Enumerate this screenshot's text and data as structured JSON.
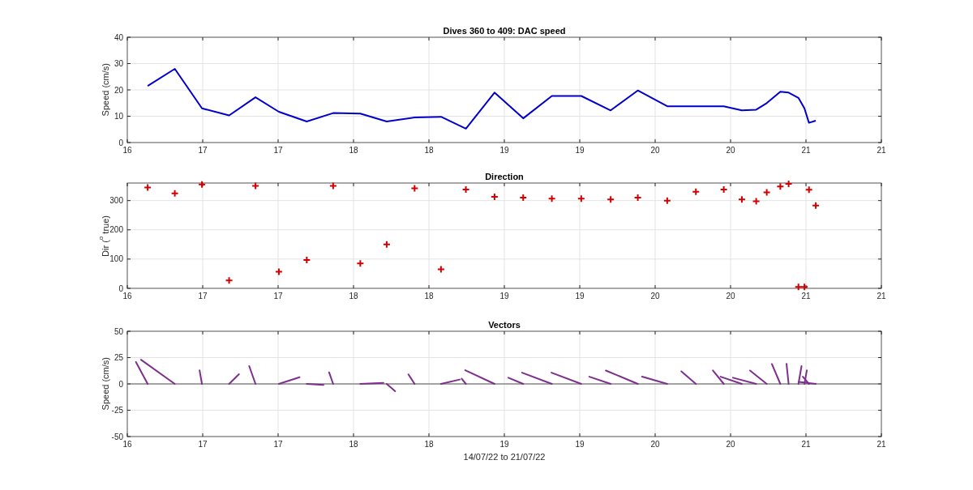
{
  "figure": {
    "panels": [
      {
        "kind": "chart",
        "chart_data": {
          "type": "line",
          "title": "Dives 360 to 409: DAC speed",
          "ylabel": "Speed (cm/s)",
          "x": [
            16.135,
            16.315,
            16.495,
            16.675,
            16.85,
            17.005,
            17.19,
            17.365,
            17.545,
            17.72,
            17.905,
            18.08,
            18.245,
            18.435,
            18.625,
            18.815,
            19.01,
            19.205,
            19.385,
            19.58,
            19.77,
            19.955,
            20.075,
            20.17,
            20.24,
            20.33,
            20.385,
            20.45,
            20.49,
            20.52,
            20.565
          ],
          "series": [
            {
              "color": "#0000cd",
              "values": [
                21.5,
                28,
                13,
                10.3,
                17.2,
                11.7,
                8,
                11.2,
                11,
                8,
                9.5,
                9.8,
                5.3,
                19,
                9.2,
                17.7,
                17.7,
                12.2,
                19.8,
                13.8,
                13.8,
                13.8,
                12.2,
                12.5,
                15,
                19.3,
                19,
                17,
                13,
                7.5,
                8.3
              ]
            }
          ],
          "xlim": [
            16,
            21
          ],
          "ylim": [
            0,
            40
          ],
          "xticks": [
            {
              "value": 16,
              "label": "16"
            },
            {
              "value": 16.5,
              "label": "17"
            },
            {
              "value": 17,
              "label": "17"
            },
            {
              "value": 17.5,
              "label": "18"
            },
            {
              "value": 18,
              "label": "18"
            },
            {
              "value": 18.5,
              "label": "19"
            },
            {
              "value": 19,
              "label": "19"
            },
            {
              "value": 19.5,
              "label": "20"
            },
            {
              "value": 20,
              "label": "20"
            },
            {
              "value": 20.5,
              "label": "21"
            },
            {
              "value": 21,
              "label": "21"
            }
          ],
          "yticks": [
            0,
            10,
            20,
            30,
            40
          ],
          "grid": true
        }
      },
      {
        "kind": "chart",
        "chart_data": {
          "type": "scatter",
          "title": "Direction",
          "ylabel": "Dir ($^{o}$ true)",
          "x": [
            16.135,
            16.315,
            16.495,
            16.675,
            16.85,
            17.005,
            17.19,
            17.365,
            17.545,
            17.72,
            17.905,
            18.08,
            18.245,
            18.435,
            18.625,
            18.815,
            19.01,
            19.205,
            19.385,
            19.58,
            19.77,
            19.955,
            20.075,
            20.17,
            20.24,
            20.33,
            20.385,
            20.45,
            20.49,
            20.52,
            20.565
          ],
          "series": [
            {
              "color": "#d40000",
              "values": [
                345,
                325,
                355,
                27,
                350,
                57,
                97,
                350,
                85,
                150,
                342,
                65,
                338,
                313,
                310,
                307,
                307,
                304,
                310,
                300,
                330,
                338,
                304,
                298,
                328,
                348,
                357,
                5,
                5,
                337,
                283
              ]
            }
          ],
          "xlim": [
            16,
            21
          ],
          "ylim": [
            0,
            360
          ],
          "xticks": [
            {
              "value": 16,
              "label": "16"
            },
            {
              "value": 16.5,
              "label": "17"
            },
            {
              "value": 17,
              "label": "17"
            },
            {
              "value": 17.5,
              "label": "18"
            },
            {
              "value": 18,
              "label": "18"
            },
            {
              "value": 18.5,
              "label": "19"
            },
            {
              "value": 19,
              "label": "19"
            },
            {
              "value": 19.5,
              "label": "20"
            },
            {
              "value": 20,
              "label": "20"
            },
            {
              "value": 20.5,
              "label": "21"
            },
            {
              "value": 21,
              "label": "21"
            }
          ],
          "yticks": [
            0,
            100,
            200,
            300
          ],
          "grid": true
        }
      },
      {
        "kind": "vectors",
        "title": "Vectors",
        "ylabel": "Speed (cm/s)",
        "xlabel": "14/07/22 to 21/07/22",
        "color": "#7e2f8e",
        "xticks": [
          "16",
          "17",
          "17",
          "18",
          "18",
          "19",
          "19",
          "20",
          "20",
          "21",
          "21"
        ],
        "yticks": [
          "50",
          "25",
          "0",
          "-25",
          "-50"
        ]
      }
    ]
  }
}
